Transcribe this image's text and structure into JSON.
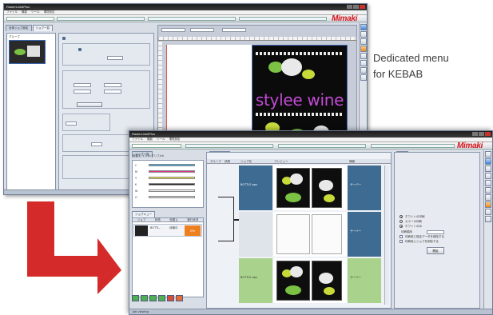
{
  "caption": {
    "line1": "Dedicated menu",
    "line2": "for KEBAB"
  },
  "colors": {
    "brand_red": "#d8141a",
    "arrow_red": "#d42a2a",
    "selected_row_blue": "#3d6b92",
    "green_row": "#a9d38c",
    "queue_orange": "#ee7f1e",
    "art_title_magenta": "#c24ad6"
  },
  "back_window": {
    "title": "RasterLink6Plus",
    "menu": [
      "ファイル",
      "機能",
      "ツール",
      "環境設定"
    ],
    "brand_logo": "Mimaki",
    "tabs": [
      "全体ジョブ設定",
      "ジョブ一覧"
    ],
    "list_label": "グループ",
    "artwork_text": "stylee wine",
    "icons": [
      "print-icon",
      "color-icon",
      "layout-icon",
      "cut-icon",
      "settings-icon",
      "info-icon",
      "list-icon",
      "preview-icon"
    ]
  },
  "front_window": {
    "title": "RasterLink6Plus",
    "menu": [
      "ファイル",
      "機能",
      "ツール",
      "環境設定"
    ],
    "brand_logo": "Mimaki",
    "tab_left": "ジョブ一覧",
    "tab_right": "一覧",
    "color_panel_label": "色替え  インキ:グリフ/ch",
    "ink_rows": [
      "C",
      "M",
      "Y",
      "K",
      "W",
      "Cl"
    ],
    "queue_tab": "ジョブキュー",
    "queue_columns": [
      "ジョブ",
      "状態",
      "色替え",
      "進行状況"
    ],
    "queue_item": {
      "name": "BOTTL..",
      "state": "待機中",
      "percent": "0%"
    },
    "grid_columns": [
      "グループ",
      "状態",
      "ジョブ名",
      "プレビュー",
      "情報"
    ],
    "rows": [
      {
        "name": "BOTTLE.eps",
        "side": "サーバー",
        "style": "blue"
      },
      {
        "name": "",
        "side": "サーバー",
        "style": "gray"
      },
      {
        "name": "BOTTLE.eps",
        "side": "サーバー",
        "style": "green"
      }
    ],
    "options": [
      {
        "label": "ホワイトの印刷",
        "checked": true
      },
      {
        "label": "カラーの印刷",
        "checked": false
      },
      {
        "label": "ホワイトのみ",
        "checked": true
      },
      {
        "label": "印刷順序",
        "checked": false
      },
      {
        "label": "印刷前に指定データを削除する",
        "checked": false
      },
      {
        "label": "印刷後にジョブを削除する",
        "checked": false
      }
    ],
    "start_button": "開始",
    "status": "Job viewing",
    "icons": [
      "settings-icon",
      "print-icon",
      "color-icon",
      "layout-icon",
      "cut-icon",
      "preview-icon",
      "info-icon",
      "list-icon",
      "queue-icon",
      "tool-icon"
    ]
  }
}
